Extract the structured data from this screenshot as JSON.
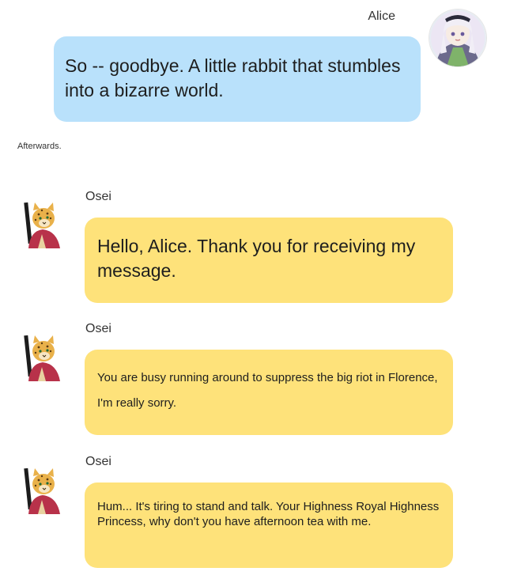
{
  "alice": {
    "name": "Alice",
    "message": "So -- goodbye. A little rabbit that stumbles into a bizarre world.",
    "avatar_icon": "alice-avatar-icon"
  },
  "separator_note": "Afterwards.",
  "osei": {
    "avatar_icon": "leopard-avatar-icon",
    "messages": [
      {
        "name": "Osei",
        "text": "Hello, Alice. Thank you for receiving my message."
      },
      {
        "name": "Osei",
        "text": "You are busy running around to suppress the big riot in Florence, I'm really sorry."
      },
      {
        "name": "Osei",
        "text": "Hum... It's tiring to stand and talk. Your Highness Royal Highness Princess, why don't you have afternoon tea with me."
      }
    ]
  },
  "colors": {
    "alice_bubble": "#b9e1fb",
    "osei_bubble": "#fee27a",
    "background": "#ffffff"
  }
}
